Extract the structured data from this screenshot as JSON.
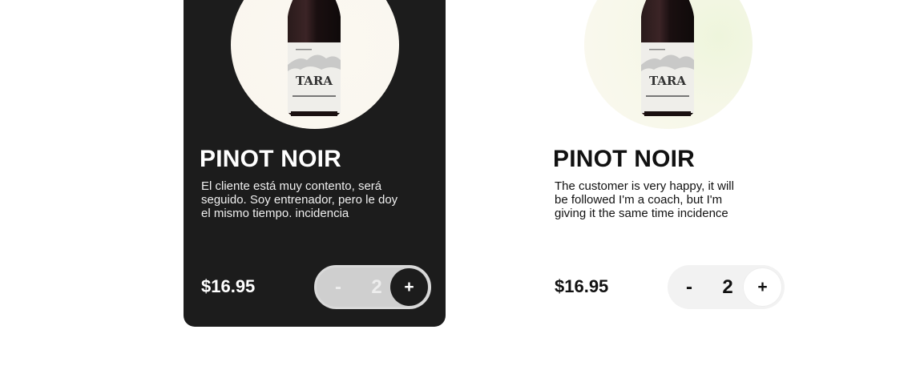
{
  "products": [
    {
      "theme": "dark",
      "title": "PINOT NOIR",
      "description_lines": [
        "El cliente está muy contento, será",
        "seguido. Soy entrenador, pero le doy",
        "el mismo tiempo. incidencia"
      ],
      "price": "$16.95",
      "quantity": "2",
      "minus_label": "-",
      "plus_label": "+",
      "label_text": "TARA"
    },
    {
      "theme": "light",
      "title": "PINOT NOIR",
      "description_lines": [
        "The customer is very happy, it will",
        "be followed I'm a coach, but I'm",
        "giving it the same time incidence"
      ],
      "price": "$16.95",
      "quantity": "2",
      "minus_label": "-",
      "plus_label": "+",
      "label_text": "TARA"
    }
  ],
  "colors": {
    "card_dark_bg": "#1c1c1c",
    "text_light": "#ffffff",
    "text_dark": "#111111"
  },
  "icons": {
    "product_image": "wine-bottle-icon"
  }
}
